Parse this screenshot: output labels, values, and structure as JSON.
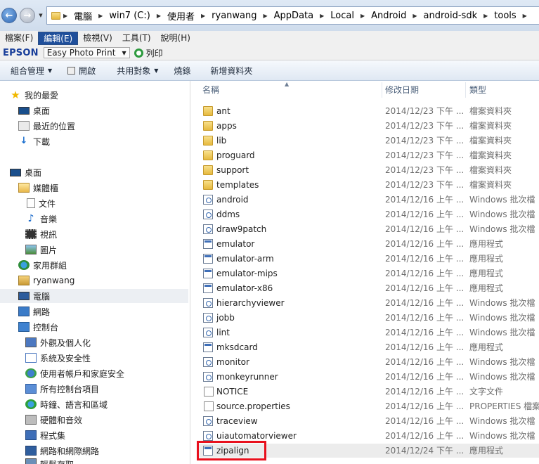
{
  "breadcrumbs": [
    "電腦",
    "win7 (C:)",
    "使用者",
    "ryanwang",
    "AppData",
    "Local",
    "Android",
    "android-sdk",
    "tools"
  ],
  "menu": {
    "items": [
      {
        "label": "檔案(F)",
        "active": false
      },
      {
        "label": "編輯(E)",
        "active": true
      },
      {
        "label": "檢視(V)",
        "active": false
      },
      {
        "label": "工具(T)",
        "active": false
      },
      {
        "label": "說明(H)",
        "active": false
      }
    ]
  },
  "epson": {
    "brand": "EPSON",
    "app": "Easy Photo Print",
    "print_label": "列印"
  },
  "toolbar": {
    "organize": "組合管理",
    "open": "開啟",
    "share": "共用對象",
    "burn": "燒錄",
    "new_folder": "新增資料夾"
  },
  "nav": {
    "favorites": "我的最愛",
    "fav_desktop": "桌面",
    "fav_recent": "最近的位置",
    "fav_downloads": "下載",
    "desktop": "桌面",
    "libraries": "媒體櫃",
    "documents": "文件",
    "music": "音樂",
    "videos": "視訊",
    "pictures": "圖片",
    "homegroup": "家用群組",
    "user": "ryanwang",
    "computer": "電腦",
    "network": "網路",
    "control_panel": "控制台",
    "cp_appearance": "外觀及個人化",
    "cp_security": "系統及安全性",
    "cp_users": "使用者帳戶和家庭安全",
    "cp_all": "所有控制台項目",
    "cp_clock": "時鐘、語言和區域",
    "cp_hardware": "硬體和音效",
    "cp_programs": "程式集",
    "cp_network": "網路和網際網路",
    "cp_partial": "輕鬆存取"
  },
  "columns": {
    "name": "名稱",
    "modified": "修改日期",
    "type": "類型"
  },
  "files": [
    {
      "name": "ant",
      "date": "2014/12/23 下午 ...",
      "type": "檔案資料夾",
      "icon": "folder"
    },
    {
      "name": "apps",
      "date": "2014/12/23 下午 ...",
      "type": "檔案資料夾",
      "icon": "folder"
    },
    {
      "name": "lib",
      "date": "2014/12/23 下午 ...",
      "type": "檔案資料夾",
      "icon": "folder"
    },
    {
      "name": "proguard",
      "date": "2014/12/23 下午 ...",
      "type": "檔案資料夾",
      "icon": "folder"
    },
    {
      "name": "support",
      "date": "2014/12/23 下午 ...",
      "type": "檔案資料夾",
      "icon": "folder"
    },
    {
      "name": "templates",
      "date": "2014/12/23 下午 ...",
      "type": "檔案資料夾",
      "icon": "folder"
    },
    {
      "name": "android",
      "date": "2014/12/16 上午 ...",
      "type": "Windows 批次檔",
      "icon": "batch"
    },
    {
      "name": "ddms",
      "date": "2014/12/16 上午 ...",
      "type": "Windows 批次檔",
      "icon": "batch"
    },
    {
      "name": "draw9patch",
      "date": "2014/12/16 上午 ...",
      "type": "Windows 批次檔",
      "icon": "batch"
    },
    {
      "name": "emulator",
      "date": "2014/12/16 上午 ...",
      "type": "應用程式",
      "icon": "exe"
    },
    {
      "name": "emulator-arm",
      "date": "2014/12/16 上午 ...",
      "type": "應用程式",
      "icon": "exe"
    },
    {
      "name": "emulator-mips",
      "date": "2014/12/16 上午 ...",
      "type": "應用程式",
      "icon": "exe"
    },
    {
      "name": "emulator-x86",
      "date": "2014/12/16 上午 ...",
      "type": "應用程式",
      "icon": "exe"
    },
    {
      "name": "hierarchyviewer",
      "date": "2014/12/16 上午 ...",
      "type": "Windows 批次檔",
      "icon": "batch"
    },
    {
      "name": "jobb",
      "date": "2014/12/16 上午 ...",
      "type": "Windows 批次檔",
      "icon": "batch"
    },
    {
      "name": "lint",
      "date": "2014/12/16 上午 ...",
      "type": "Windows 批次檔",
      "icon": "batch"
    },
    {
      "name": "mksdcard",
      "date": "2014/12/16 上午 ...",
      "type": "應用程式",
      "icon": "exe"
    },
    {
      "name": "monitor",
      "date": "2014/12/16 上午 ...",
      "type": "Windows 批次檔",
      "icon": "batch"
    },
    {
      "name": "monkeyrunner",
      "date": "2014/12/16 上午 ...",
      "type": "Windows 批次檔",
      "icon": "batch"
    },
    {
      "name": "NOTICE",
      "date": "2014/12/16 上午 ...",
      "type": "文字文件",
      "icon": "text"
    },
    {
      "name": "source.properties",
      "date": "2014/12/16 上午 ...",
      "type": "PROPERTIES 檔案",
      "icon": "text"
    },
    {
      "name": "traceview",
      "date": "2014/12/16 上午 ...",
      "type": "Windows 批次檔",
      "icon": "batch"
    },
    {
      "name": "uiautomatorviewer",
      "date": "2014/12/16 上午 ...",
      "type": "Windows 批次檔",
      "icon": "batch"
    },
    {
      "name": "zipalign",
      "date": "2014/12/24 下午 ...",
      "type": "應用程式",
      "icon": "exe",
      "selected": true
    }
  ],
  "colors": {
    "highlight": "#e8101d",
    "menu_active": "#1f4f9b",
    "epson_brand": "#1a3f9a"
  }
}
